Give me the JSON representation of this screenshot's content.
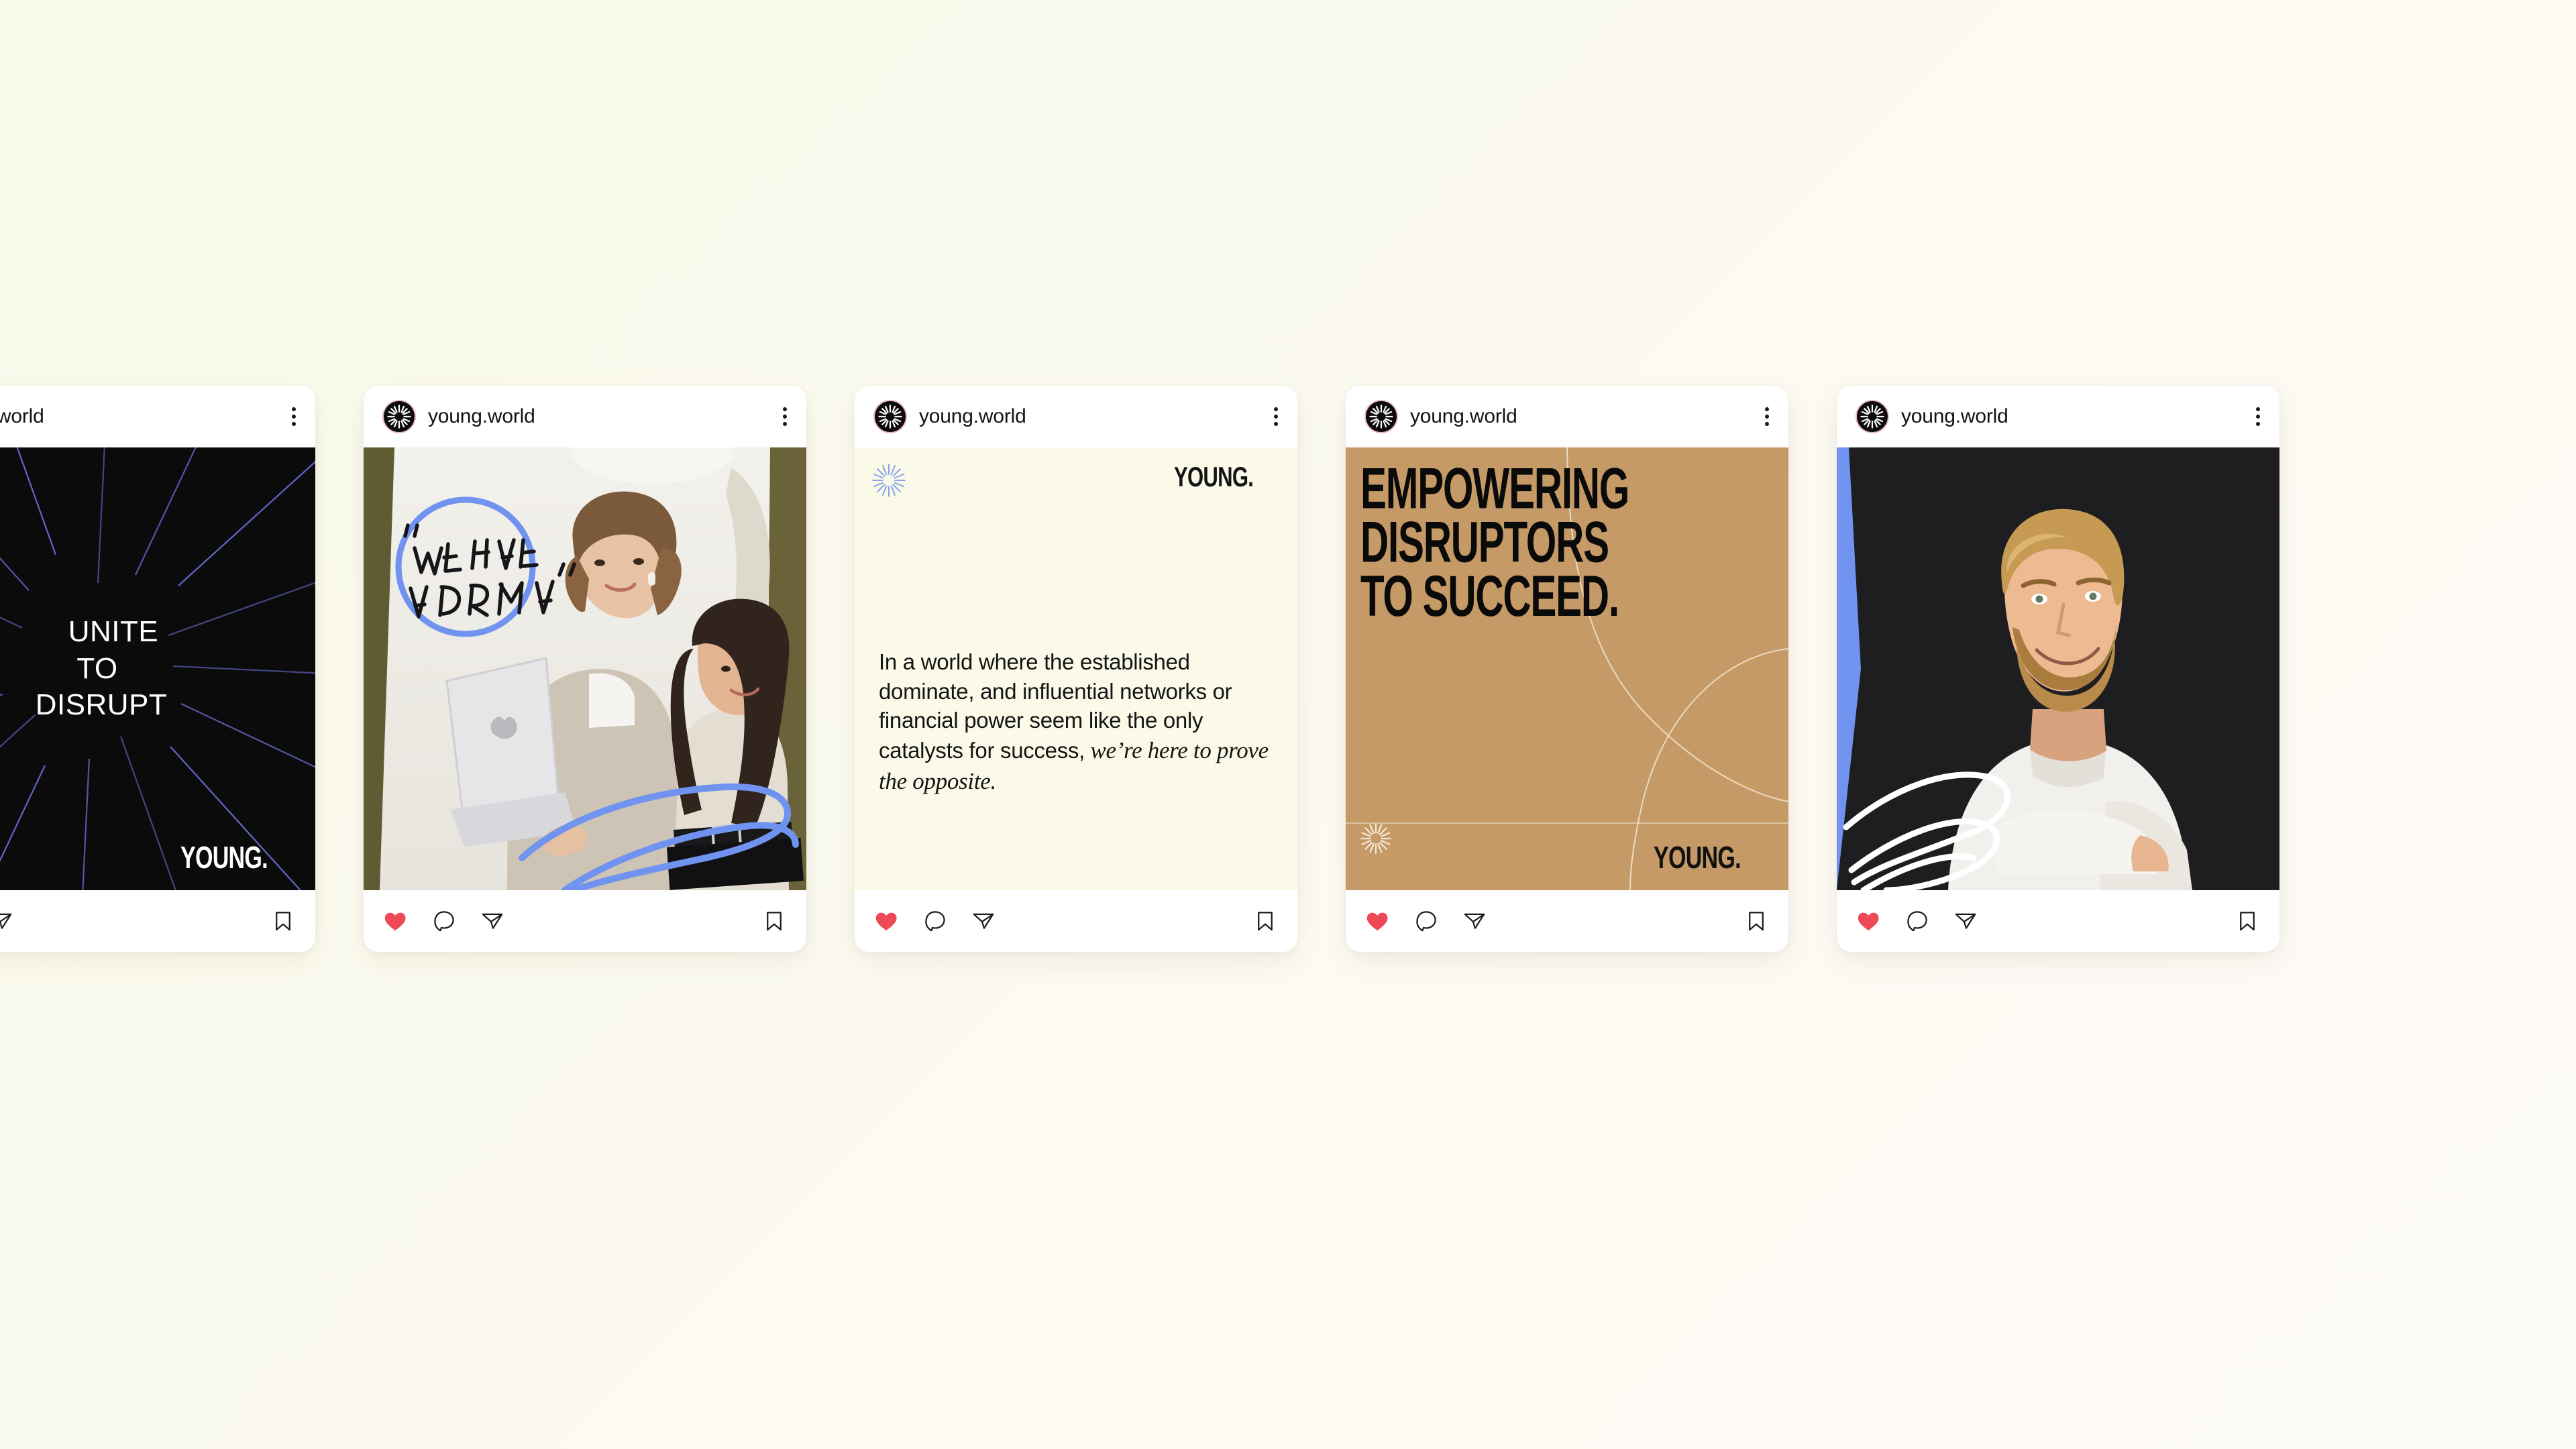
{
  "background": {
    "color_top": "#f9faec",
    "color_bottom": "#fdfbf7"
  },
  "brand": {
    "name": "YOUNG.",
    "handle": "young.world",
    "accent_blue": "#6f93ef",
    "accent_tan": "#c59a66",
    "accent_cream": "#fbfae9",
    "accent_black": "#0b0b0b",
    "avatar_ring": "#e8b9c4"
  },
  "actions": {
    "like_label": "Like",
    "comment_label": "Comment",
    "share_label": "Share",
    "save_label": "Save",
    "liked": true,
    "like_color": "#ed4956"
  },
  "menu": {
    "more_label": "More options"
  },
  "posts": [
    {
      "id": "post-1",
      "handle": "young.world",
      "kind": "graphic-dark",
      "headline_lines": [
        "UNITE",
        "TO",
        "DISRUPT"
      ],
      "logo": "YOUNG.",
      "logo_position": "bottom-right",
      "bg": "#0b0b0b",
      "ray_color": "#6f77e8"
    },
    {
      "id": "post-2",
      "handle": "young.world",
      "kind": "photo",
      "photo_description": "Two women in business casual looking at an open laptop",
      "annotation": "“WE HAVE A DREAM”",
      "annotation_shape": "circle",
      "annotation_color": "#6f93ef",
      "scribble_color": "#6f93ef"
    },
    {
      "id": "post-3",
      "handle": "young.world",
      "kind": "quote",
      "bg": "#fbfae9",
      "logo": "YOUNG.",
      "logo_position": "top-right",
      "burst_position": "top-left",
      "burst_color": "#8aa4e8",
      "quote_regular": "In a world where the established dominate, and influential networks or financial power seem like the only catalysts for success,",
      "quote_italic": " we’re here to prove the opposite."
    },
    {
      "id": "post-4",
      "handle": "young.world",
      "kind": "graphic-tan",
      "bg": "#c59a66",
      "headline_lines": [
        "EMPOWERING",
        "DISRUPTORS",
        "TO SUCCEED."
      ],
      "logo": "YOUNG.",
      "logo_position": "bottom-right",
      "burst_position": "bottom-left",
      "burst_color": "#f3ead8",
      "arc_color": "#f0e6d2"
    },
    {
      "id": "post-5",
      "handle": "young.world",
      "kind": "photo",
      "photo_description": "Smiling bearded man in a white t-shirt with arms crossed on a dark background",
      "edge_color": "#6f93ef",
      "scribble_color": "#ffffff"
    }
  ]
}
